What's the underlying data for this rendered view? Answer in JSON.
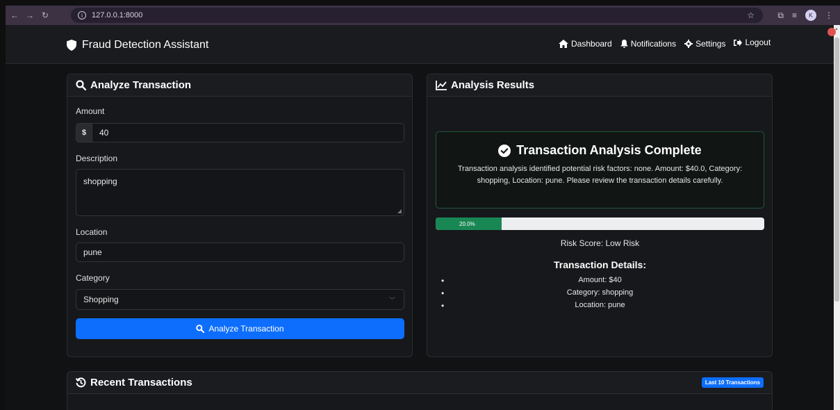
{
  "browser": {
    "url": "127.0.0.1:8000",
    "avatar_letter": "K"
  },
  "navbar": {
    "brand": "Fraud Detection Assistant",
    "links": {
      "dashboard": "Dashboard",
      "notifications": "Notifications",
      "settings": "Settings",
      "logout": "Logout"
    }
  },
  "analyze": {
    "title": "Analyze Transaction",
    "amount_label": "Amount",
    "currency": "$",
    "amount_value": "40",
    "description_label": "Description",
    "description_value": "shopping",
    "location_label": "Location",
    "location_value": "pune",
    "category_label": "Category",
    "category_value": "Shopping",
    "button": "Analyze Transaction"
  },
  "results": {
    "title": "Analysis Results",
    "alert_title": "Transaction Analysis Complete",
    "alert_text": "Transaction analysis identified potential risk factors: none. Amount: $40.0, Category: shopping, Location: pune. Please review the transaction details carefully.",
    "progress_label": "20.0%",
    "progress_fraction": 0.2,
    "risk_score": "Risk Score: Low Risk",
    "details_title": "Transaction Details:",
    "details": {
      "amount": "Amount: $40",
      "category": "Category: shopping",
      "location": "Location: pune"
    }
  },
  "recent": {
    "title": "Recent Transactions",
    "badge": "Last 10 Transactions"
  },
  "colors": {
    "primary": "#0d6efd",
    "success": "#198754",
    "background": "#111214"
  }
}
